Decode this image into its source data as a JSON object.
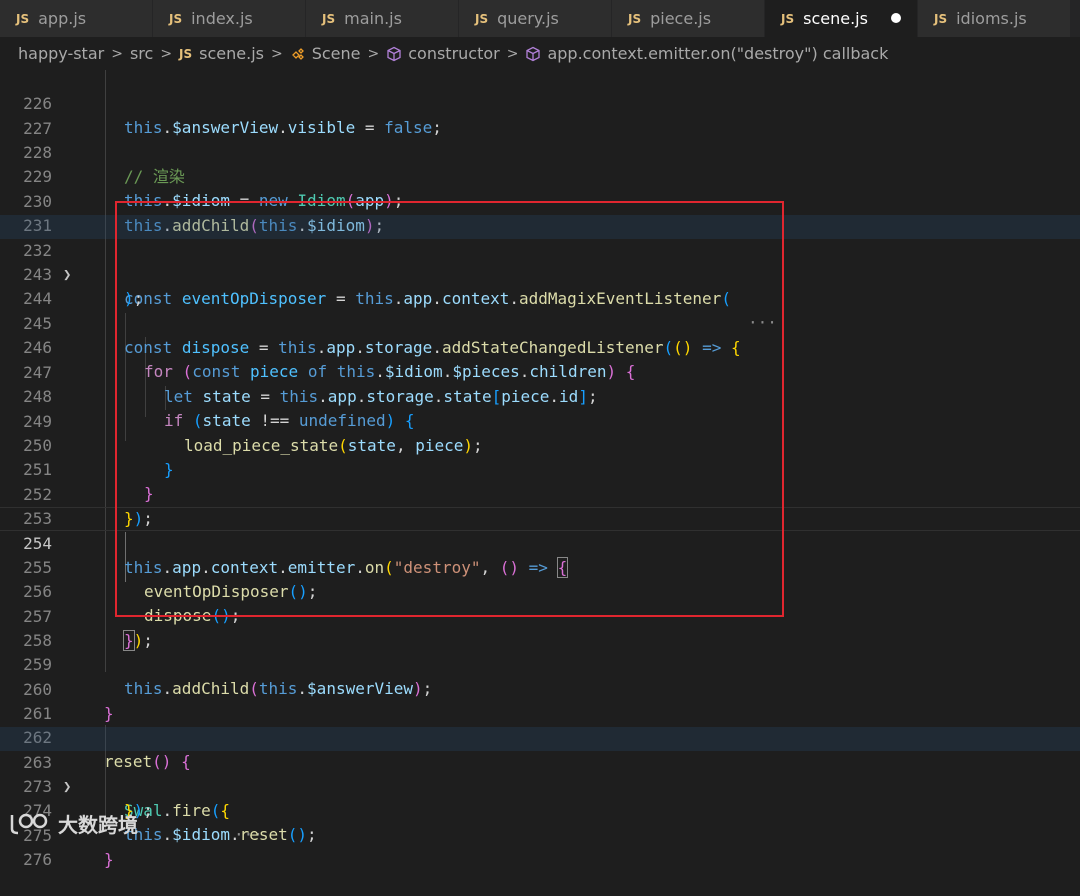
{
  "tabs": [
    {
      "badge": "JS",
      "label": "app.js"
    },
    {
      "badge": "JS",
      "label": "index.js"
    },
    {
      "badge": "JS",
      "label": "main.js"
    },
    {
      "badge": "JS",
      "label": "query.js"
    },
    {
      "badge": "JS",
      "label": "piece.js"
    },
    {
      "badge": "JS",
      "label": "scene.js"
    },
    {
      "badge": "JS",
      "label": "idioms.js"
    }
  ],
  "active_tab": "scene.js",
  "breadcrumb": {
    "project": "happy-star",
    "folder": "src",
    "file_badge": "JS",
    "file": "scene.js",
    "class_name": "Scene",
    "method": "constructor",
    "callback": "app.context.emitter.on(\"destroy\") callback"
  },
  "lines": {
    "n226": "226",
    "n227": "227",
    "n228": "228",
    "n229": "229",
    "n230": "230",
    "n231": "231",
    "n232": "232",
    "n243": "243",
    "n244": "244",
    "n245": "245",
    "n246": "246",
    "n247": "247",
    "n248": "248",
    "n249": "249",
    "n250": "250",
    "n251": "251",
    "n252": "252",
    "n253": "253",
    "n254": "254",
    "n255": "255",
    "n256": "256",
    "n257": "257",
    "n258": "258",
    "n259": "259",
    "n260": "260",
    "n261": "261",
    "n262": "262",
    "n263": "263",
    "n273": "273",
    "n274": "274",
    "n275": "275",
    "n276": "276"
  },
  "code": {
    "comment_render": "// 渲染",
    "string_destroy": "\"destroy\"",
    "bool_false": "false",
    "ellipsis": "···"
  },
  "watermark": {
    "text": "大数跨境"
  },
  "colors": {
    "highlight_box": "#e0262f",
    "js_badge": "#e5c07b"
  }
}
